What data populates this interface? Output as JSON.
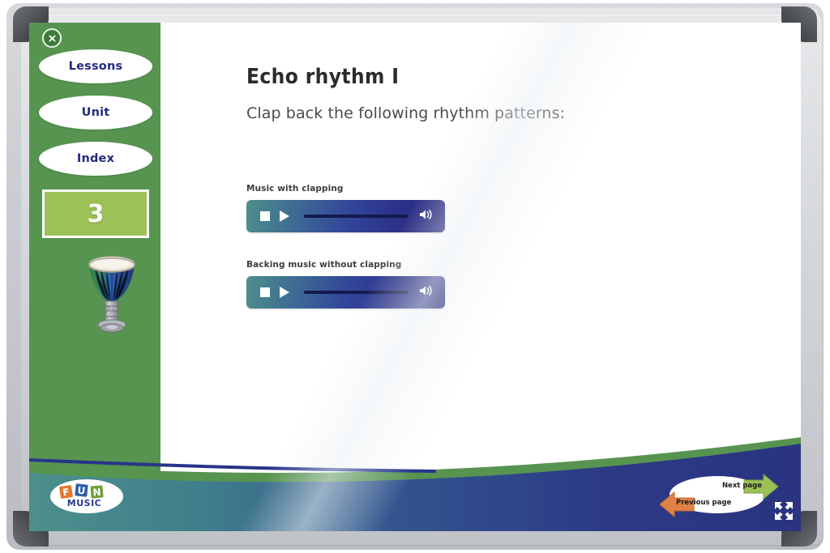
{
  "app": {
    "close_label": "Close",
    "close_icon": "close-circle-icon"
  },
  "colors": {
    "sidebar_green": "#579450",
    "badge_green": "#9cc157",
    "wave_navy": "#2a3d86",
    "wave_teal": "#4d8f8c",
    "nav_text_navy": "#242a80",
    "arrow_next_green": "#9cc157",
    "arrow_prev_orange": "#e08245",
    "player_gradient_from": "#4d8f8c",
    "player_gradient_to": "#2a2d7e"
  },
  "sidebar": {
    "items": [
      {
        "label": "Lessons",
        "name": "sidebar-item-lessons"
      },
      {
        "label": "Unit",
        "name": "sidebar-item-unit"
      },
      {
        "label": "Index",
        "name": "sidebar-item-index"
      }
    ],
    "page_number": "3",
    "illustration": "djembe-drum-icon"
  },
  "main": {
    "title": "Echo rhythm I",
    "subtitle": "Clap back the following rhythm patterns:",
    "players": [
      {
        "label": "Music with clapping",
        "stop_icon": "stop-icon",
        "play_icon": "play-icon",
        "volume_icon": "volume-icon",
        "progress": "0"
      },
      {
        "label": "Backing music without clapping",
        "stop_icon": "stop-icon",
        "play_icon": "play-icon",
        "volume_icon": "volume-icon",
        "progress": "0"
      }
    ]
  },
  "footer": {
    "logo_text_top": "FUN",
    "logo_text_bottom": "MUSIC",
    "next_page_label": "Next page",
    "previous_page_label": "Previous page",
    "fullscreen_icon": "fullscreen-expand-icon"
  }
}
